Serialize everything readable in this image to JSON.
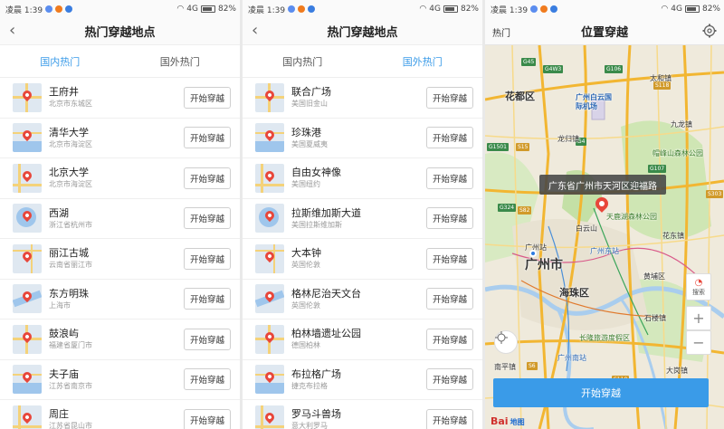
{
  "status": {
    "time": "凌晨 1:39",
    "network": "4G",
    "battery": "82%"
  },
  "screen_domestic": {
    "title": "热门穿越地点",
    "tabs": [
      "国内热门",
      "国外热门"
    ],
    "active_tab": 0,
    "items": [
      {
        "name": "王府井",
        "addr": "北京市东城区"
      },
      {
        "name": "清华大学",
        "addr": "北京市海淀区"
      },
      {
        "name": "北京大学",
        "addr": "北京市海淀区"
      },
      {
        "name": "西湖",
        "addr": "浙江省杭州市"
      },
      {
        "name": "丽江古城",
        "addr": "云南省丽江市"
      },
      {
        "name": "东方明珠",
        "addr": "上海市"
      },
      {
        "name": "鼓浪屿",
        "addr": "福建省厦门市"
      },
      {
        "name": "夫子庙",
        "addr": "江苏省南京市"
      },
      {
        "name": "周庄",
        "addr": "江苏省昆山市"
      }
    ]
  },
  "screen_foreign": {
    "title": "热门穿越地点",
    "tabs": [
      "国内热门",
      "国外热门"
    ],
    "active_tab": 1,
    "items": [
      {
        "name": "联合广场",
        "addr": "美国旧金山"
      },
      {
        "name": "珍珠港",
        "addr": "美国夏威夷"
      },
      {
        "name": "自由女神像",
        "addr": "美国纽约"
      },
      {
        "name": "拉斯维加斯大道",
        "addr": "美国拉斯维加斯"
      },
      {
        "name": "大本钟",
        "addr": "英国伦敦"
      },
      {
        "name": "格林尼治天文台",
        "addr": "英国伦敦"
      },
      {
        "name": "柏林墙遗址公园",
        "addr": "德国柏林"
      },
      {
        "name": "布拉格广场",
        "addr": "捷克布拉格"
      },
      {
        "name": "罗马斗兽场",
        "addr": "意大利罗马"
      }
    ]
  },
  "go_label": "开始穿越",
  "screen_map": {
    "left_label": "热门",
    "title": "位置穿越",
    "tooltip": "广东省广州市天河区迎福路",
    "start_label": "开始穿越",
    "search_label": "搜索",
    "zoom_in": "+",
    "zoom_out": "−",
    "logo_left": "Bai",
    "logo_right": "地图",
    "labels": {
      "huadu": "花都区",
      "airport": "广州白云国际机场",
      "guangzhou": "广州市",
      "haizhu": "海珠区",
      "baiyunshan": "白云山",
      "tianlu": "天鹿湖森林公园",
      "mahuang": "帽峰山森林公园",
      "east_station": "广州东站",
      "changlong": "长隆旅游度假区",
      "south_station": "广州南站",
      "nanping": "南平镇",
      "jiulong": "九龙镇",
      "taihe": "太和镇",
      "guangzhou_station": "广州站",
      "huangpu": "黄埔区",
      "dagang": "大岗镇",
      "shilou": "石楼镇",
      "huadong": "花东镇",
      "longgui": "龙归镇"
    },
    "roads": [
      "G45",
      "G4W3",
      "G106",
      "G4",
      "S118",
      "G107",
      "G1501",
      "S15",
      "G324",
      "G0425",
      "S303",
      "S6",
      "S82",
      "S110"
    ]
  }
}
